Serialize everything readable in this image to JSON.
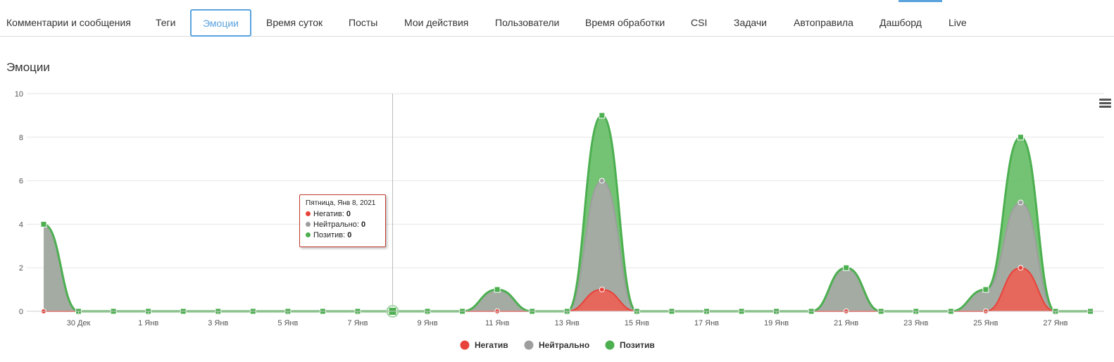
{
  "tabs": [
    {
      "label": "Комментарии и сообщения"
    },
    {
      "label": "Теги"
    },
    {
      "label": "Эмоции",
      "active": true
    },
    {
      "label": "Время суток"
    },
    {
      "label": "Посты"
    },
    {
      "label": "Мои действия"
    },
    {
      "label": "Пользователи"
    },
    {
      "label": "Время обработки"
    },
    {
      "label": "CSI"
    },
    {
      "label": "Задачи"
    },
    {
      "label": "Автоправила"
    },
    {
      "label": "Дашборд"
    },
    {
      "label": "Live"
    }
  ],
  "page_title": "Эмоции",
  "tooltip": {
    "title": "Пятница, Янв 8, 2021",
    "rows": [
      {
        "name": "Негатив",
        "value": "0"
      },
      {
        "name": "Нейтрально",
        "value": "0"
      },
      {
        "name": "Позитив",
        "value": "0"
      }
    ]
  },
  "colors": {
    "accent": "#5aa3df",
    "negative": "#e8433a",
    "neutral": "#9e9e9e",
    "positive": "#4caf50"
  },
  "icons": {
    "menu": "hamburger-menu-icon"
  },
  "chart_data": {
    "type": "area",
    "stacked": true,
    "x": [
      "29 Дек",
      "30 Дек",
      "31 Дек",
      "1 Янв",
      "2 Янв",
      "3 Янв",
      "4 Янв",
      "5 Янв",
      "6 Янв",
      "7 Янв",
      "8 Янв",
      "9 Янв",
      "10 Янв",
      "11 Янв",
      "12 Янв",
      "13 Янв",
      "14 Янв",
      "15 Янв",
      "16 Янв",
      "17 Янв",
      "18 Янв",
      "19 Янв",
      "20 Янв",
      "21 Янв",
      "22 Янв",
      "23 Янв",
      "24 Янв",
      "25 Янв",
      "26 Янв",
      "27 Янв",
      "28 Янв"
    ],
    "tick_labels": [
      "30 Дек",
      "1 Янв",
      "3 Янв",
      "5 Янв",
      "7 Янв",
      "9 Янв",
      "11 Янв",
      "13 Янв",
      "15 Янв",
      "17 Янв",
      "19 Янв",
      "21 Янв",
      "23 Янв",
      "25 Янв",
      "27 Янв"
    ],
    "series": [
      {
        "name": "Негатив",
        "values": [
          0,
          0,
          0,
          0,
          0,
          0,
          0,
          0,
          0,
          0,
          0,
          0,
          0,
          0,
          0,
          0,
          1,
          0,
          0,
          0,
          0,
          0,
          0,
          0,
          0,
          0,
          0,
          0,
          2,
          0,
          0
        ]
      },
      {
        "name": "Нейтрально",
        "values": [
          4,
          0,
          0,
          0,
          0,
          0,
          0,
          0,
          0,
          0,
          0,
          0,
          0,
          1,
          0,
          0,
          5,
          0,
          0,
          0,
          0,
          0,
          0,
          2,
          0,
          0,
          0,
          1,
          3,
          0,
          0
        ]
      },
      {
        "name": "Позитив",
        "values": [
          0,
          0,
          0,
          0,
          0,
          0,
          0,
          0,
          0,
          0,
          0,
          0,
          0,
          0,
          0,
          0,
          3,
          0,
          0,
          0,
          0,
          0,
          0,
          0,
          0,
          0,
          0,
          0,
          3,
          0,
          0
        ]
      }
    ],
    "ylim": [
      0,
      10
    ],
    "yticks": [
      "0",
      "2",
      "4",
      "6",
      "8",
      "10"
    ],
    "grid": true,
    "legend_position": "bottom-center",
    "highlighted_x": "8 Янв"
  }
}
